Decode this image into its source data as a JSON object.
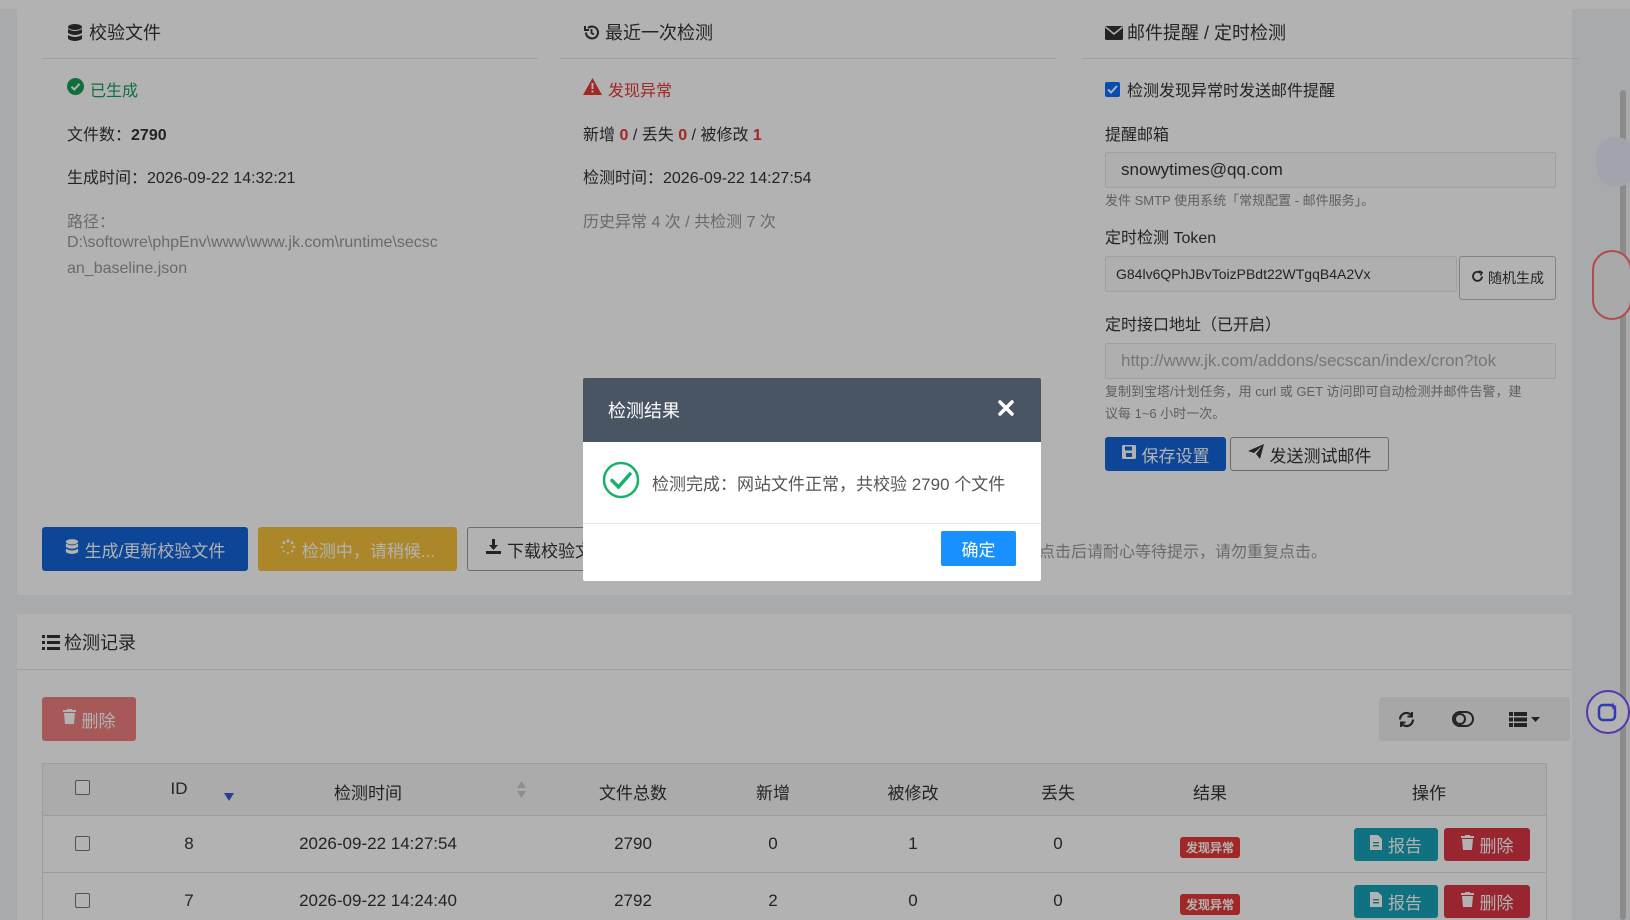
{
  "baseline": {
    "title": "校验文件",
    "status": "已生成",
    "file_count_label": "文件数：",
    "file_count": "2790",
    "generated_label": "生成时间：2026-09-22 14:32:21",
    "path_label": "路径：",
    "path_line1": "D:\\softowre\\phpEnv\\www\\www.jk.com\\runtime\\secsc",
    "path_line2": "an_baseline.json"
  },
  "last_scan": {
    "title": "最近一次检测",
    "status": "发现异常",
    "added_label": "新增",
    "added": "0",
    "lost_label": "/ 丢失",
    "lost": "0",
    "modified_label": "/ 被修改",
    "modified": "1",
    "scan_time": "检测时间：2026-09-22 14:27:54",
    "history": "历史异常 4 次 / 共检测 7 次"
  },
  "mail": {
    "title": "邮件提醒 / 定时检测",
    "checkbox_label": "检测发现异常时发送邮件提醒",
    "email_label": "提醒邮箱",
    "email_value": "snowytimes@qq.com",
    "smtp_hint": "发件 SMTP 使用系统「常规配置 - 邮件服务」。",
    "token_label": "定时检测 Token",
    "token_value": "G84lv6QPhJBvToizPBdt22WTgqB4A2Vx",
    "random_button": "随机生成",
    "api_label": "定时接口地址（已开启）",
    "api_value": "http://www.jk.com/addons/secscan/index/cron?tok",
    "api_hint_line1": "复制到宝塔/计划任务，用 curl 或 GET 访问即可自动检测并邮件告警，建",
    "api_hint_line2": "议每 1~6 小时一次。",
    "save_button": "保存设置",
    "test_button": "发送测试邮件"
  },
  "actions": {
    "generate_button": "生成/更新校验文件",
    "scanning_button": "检测中，请稍候...",
    "download_button": "下载校验文件",
    "hint": "点击后请耐心等待提示，请勿重复点击。"
  },
  "records": {
    "title": "检测记录",
    "delete_button": "删除",
    "columns": [
      "ID",
      "检测时间",
      "文件总数",
      "新增",
      "被修改",
      "丢失",
      "结果",
      "操作"
    ],
    "rows": [
      {
        "id": "8",
        "time": "2026-09-22 14:27:54",
        "total": "2790",
        "added": "0",
        "modified": "1",
        "lost": "0",
        "result": "发现异常",
        "report": "报告",
        "delete": "删除"
      },
      {
        "id": "7",
        "time": "2026-09-22 14:24:40",
        "total": "2792",
        "added": "2",
        "modified": "0",
        "lost": "0",
        "result": "发现异常",
        "report": "报告",
        "delete": "删除"
      }
    ]
  },
  "modal": {
    "title": "检测结果",
    "message": "检测完成：网站文件正常，共校验 2790 个文件",
    "ok_button": "确定"
  },
  "colors": {
    "primary": "#1565d8",
    "warning": "#f5c23c",
    "danger": "#e53935",
    "info": "#17a2b8",
    "success": "#18a058",
    "modal_header": "#4a5564"
  }
}
